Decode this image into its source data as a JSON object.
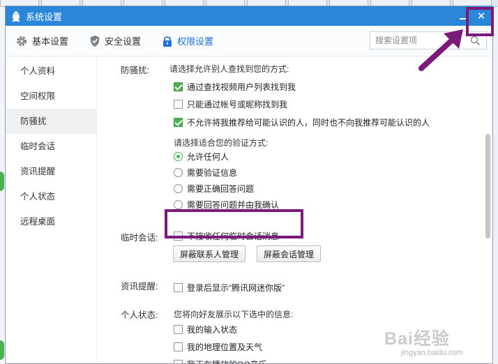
{
  "window": {
    "title": "系统设置",
    "close_symbol": "✕"
  },
  "topnav": {
    "items": [
      {
        "label": "基本设置",
        "icon": "gear-icon",
        "active": false
      },
      {
        "label": "安全设置",
        "icon": "shield-icon",
        "active": false
      },
      {
        "label": "权限设置",
        "icon": "lock-icon",
        "active": true
      }
    ],
    "search_placeholder": "搜索设置项"
  },
  "sidebar": {
    "items": [
      {
        "label": "个人资料",
        "active": false
      },
      {
        "label": "空间权限",
        "active": false
      },
      {
        "label": "防骚扰",
        "active": true
      },
      {
        "label": "临时会话",
        "active": false
      },
      {
        "label": "资讯提醒",
        "active": false
      },
      {
        "label": "个人状态",
        "active": false
      },
      {
        "label": "远程桌面",
        "active": false
      }
    ]
  },
  "anti_harass": {
    "label": "防骚扰:",
    "find_prompt": "请选择允许别人查找到您的方式:",
    "find_options": [
      {
        "label": "通过查找视频用户列表找到我",
        "checked": true
      },
      {
        "label": "只能通过帐号或昵称找到我",
        "checked": false
      },
      {
        "label": "不允许将我推荐给可能认识的人，同时也不向我推荐可能认识的人",
        "checked": true
      }
    ],
    "verify_prompt": "请选择适合您的验证方式:",
    "verify_options": [
      {
        "label": "允许任何人",
        "selected": true
      },
      {
        "label": "需要验证信息",
        "selected": false
      },
      {
        "label": "需要正确回答问题",
        "selected": false
      },
      {
        "label": "需要回答问题并由我确认",
        "selected": false
      }
    ]
  },
  "temp_session": {
    "label": "临时会话:",
    "option": {
      "label": "不接收任何临时会话消息",
      "checked": false
    },
    "buttons": [
      "屏蔽联系人管理",
      "屏蔽会话管理"
    ]
  },
  "news": {
    "label": "资讯提醒:",
    "option": {
      "label": "登录后显示“腾讯网迷你版”",
      "checked": false
    }
  },
  "status": {
    "label": "个人状态:",
    "prompt": "您将向好友展示以下选中的信息:",
    "options": [
      {
        "label": "我的输入状态",
        "checked": false
      },
      {
        "label": "我的地理位置及天气",
        "checked": false
      },
      {
        "label": "我正在播放的QQ音乐",
        "checked": false
      }
    ]
  },
  "annotation": {
    "highlight_color": "#7b1a7b"
  },
  "watermark": {
    "text": "Bai经验",
    "sub": "jingyan.baidu.com"
  },
  "colors": {
    "titlebar": "#2a86d8",
    "accent_green": "#4caf50",
    "active_nav": "#1e6fd9"
  }
}
